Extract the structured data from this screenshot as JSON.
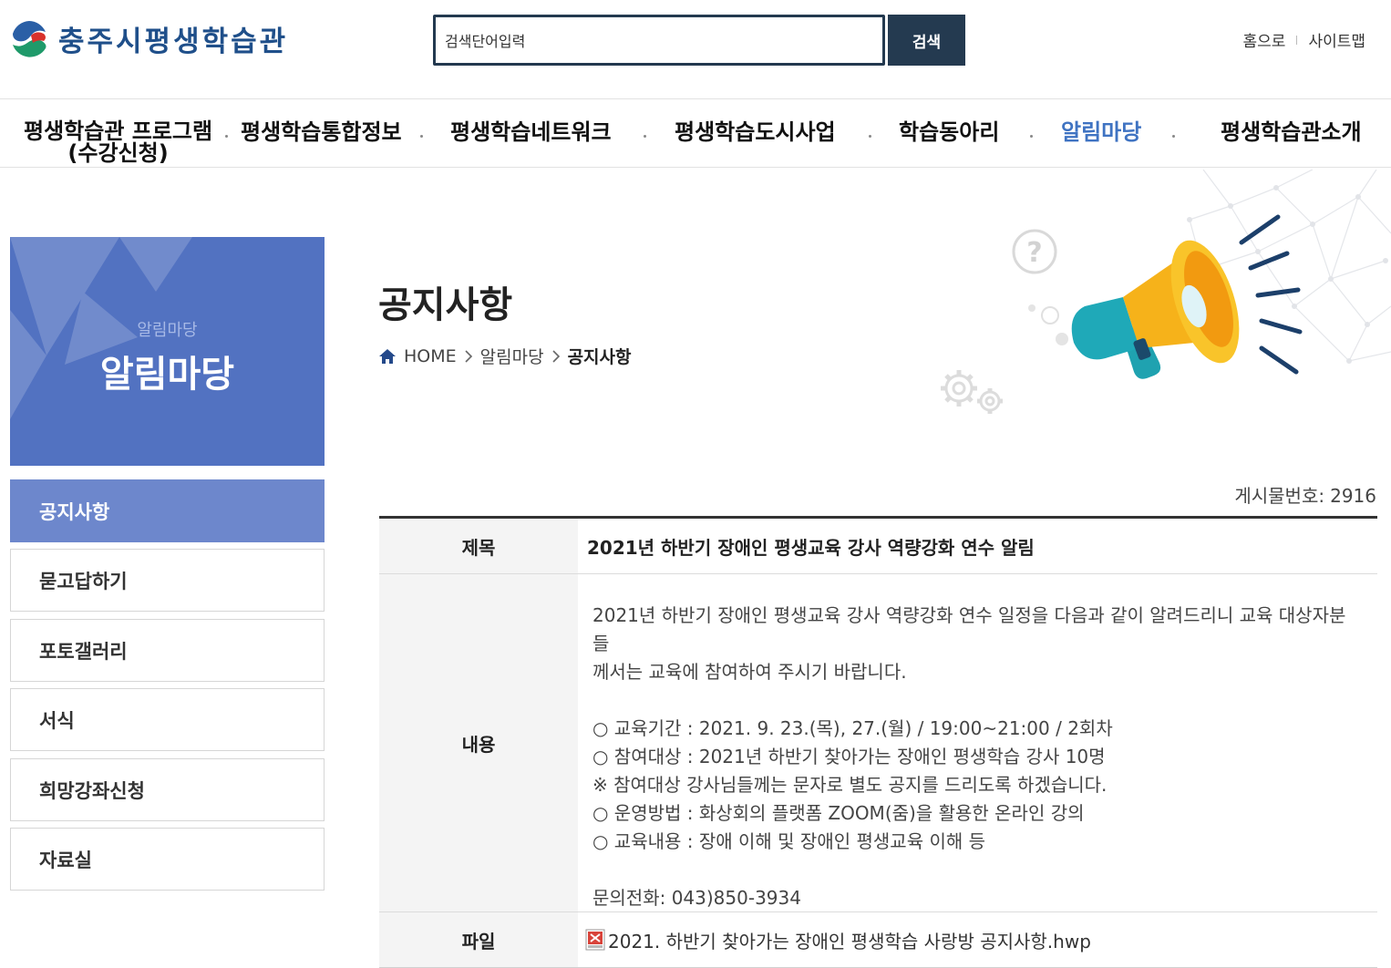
{
  "header": {
    "logo_text": "충주시평생학습관",
    "search_placeholder": "검색단어입력",
    "search_value": "검색단어입력",
    "search_button": "검색",
    "util_links": [
      "홈으로",
      "사이트맵"
    ]
  },
  "gnb": {
    "items": [
      {
        "label": "평생학습관 프로그램\n(수강신청)"
      },
      {
        "label": "평생학습통합정보"
      },
      {
        "label": "평생학습네트워크"
      },
      {
        "label": "평생학습도시사업"
      },
      {
        "label": "학습동아리"
      },
      {
        "label": "알림마당"
      },
      {
        "label": "평생학습관소개"
      }
    ],
    "active_index": 5
  },
  "sidebar": {
    "sub_title": "알림마당",
    "title": "알림마당",
    "items": [
      {
        "label": "공지사항"
      },
      {
        "label": "묻고답하기"
      },
      {
        "label": "포토갤러리"
      },
      {
        "label": "서식"
      },
      {
        "label": "희망강좌신청"
      },
      {
        "label": "자료실"
      }
    ],
    "active_index": 0
  },
  "content": {
    "page_title": "공지사항",
    "breadcrumb": [
      "HOME",
      "알림마당",
      "공지사항"
    ],
    "post_number_label": "게시물번호:",
    "post_number": "2916",
    "labels": {
      "title": "제목",
      "body": "내용",
      "file": "파일"
    },
    "title": "2021년 하반기 장애인 평생교육 강사 역량강화 연수 알림",
    "body_lines": [
      "2021년 하반기 장애인 평생교육 강사 역량강화 연수 일정을 다음과 같이 알려드리니 교육 대상자분들",
      "께서는 교육에 참여하여 주시기 바랍니다.",
      "",
      "○ 교육기간 : 2021. 9. 23.(목), 27.(월) / 19:00~21:00 / 2회차",
      "○ 참여대상 : 2021년 하반기 찾아가는 장애인 평생학습 강사 10명",
      "※ 참여대상 강사님들께는 문자로 별도 공지를 드리도록 하겠습니다.",
      "○ 운영방법 : 화상회의 플랫폼 ZOOM(줌)을 활용한 온라인 강의",
      "○ 교육내용 : 장애 이해 및 장애인 평생교육 이해 등",
      "",
      "문의전화: 043)850-3934"
    ],
    "file_name": "2021. 하반기 찾아가는 장애인 평생학습 사랑방 공지사항.hwp"
  },
  "colors": {
    "brand_dark": "#243a50",
    "sidebar_head": "#5272c1",
    "sidebar_active": "#6d87cc",
    "gnb_active": "#3f73c2"
  }
}
